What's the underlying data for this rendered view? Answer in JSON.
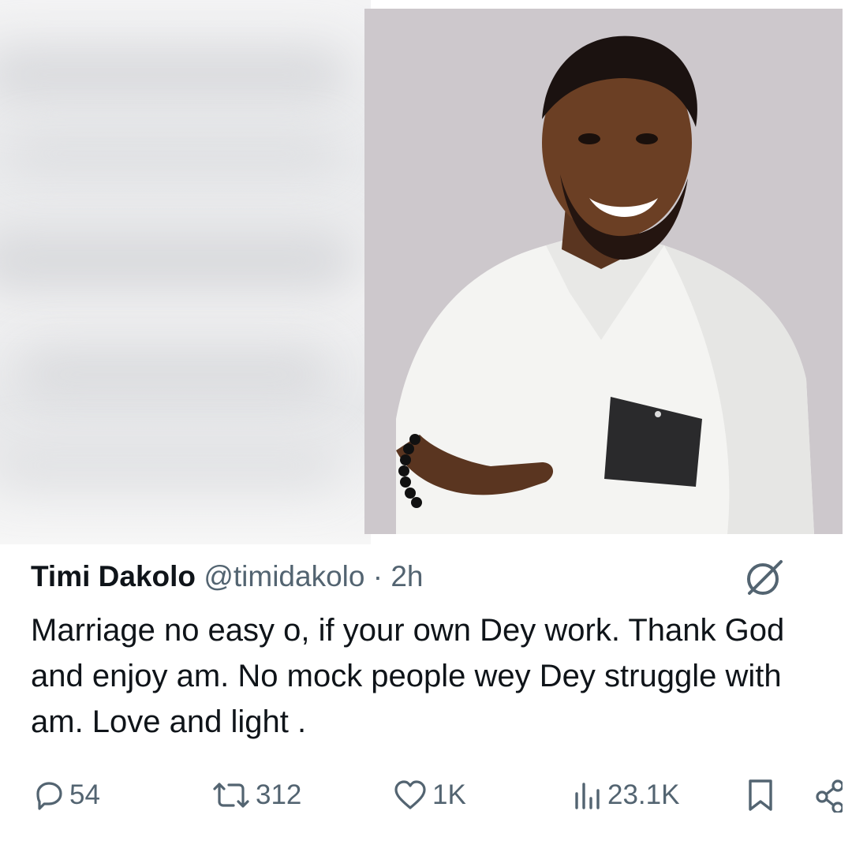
{
  "tweet": {
    "display_name": "Timi Dakolo",
    "handle": "@timidakolo",
    "separator": "·",
    "time": "2h",
    "text": "Marriage no easy o, if your own Dey work. Thank God and enjoy am. No mock people wey Dey struggle with am. Love and light ."
  },
  "actions": {
    "replies": "54",
    "retweets": "312",
    "likes": "1K",
    "views": "23.1K"
  },
  "icons": {
    "reply": "reply-icon",
    "retweet": "retweet-icon",
    "like": "heart-icon",
    "views": "views-icon",
    "bookmark": "bookmark-icon",
    "share": "share-icon",
    "grok": "grok-icon"
  },
  "colors": {
    "text_primary": "#0f1419",
    "text_secondary": "#536471",
    "background": "#ffffff"
  }
}
